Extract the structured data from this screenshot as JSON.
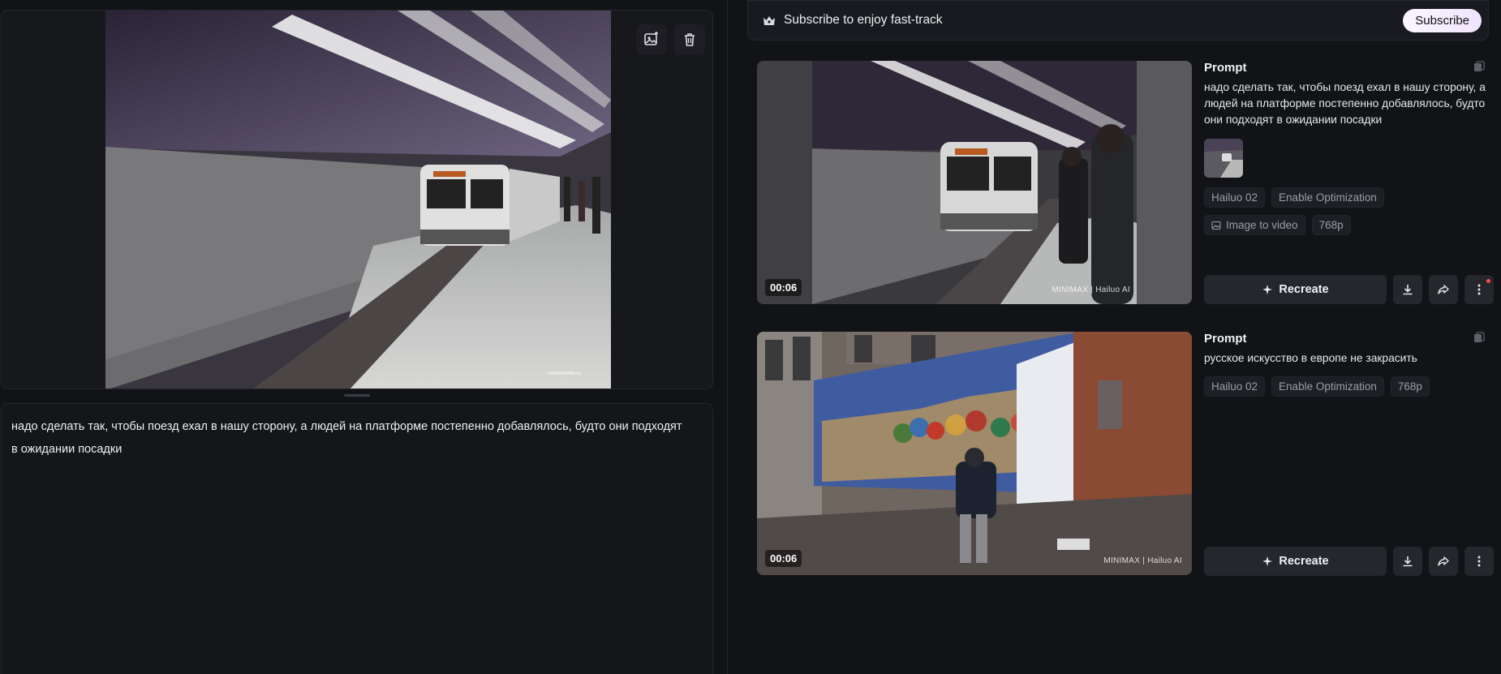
{
  "source_image": {
    "prompt_text": "надо сделать так, чтобы поезд ехал в нашу сторону, а людей на платформе постепенно добавлялось, будто они подходят в ожидании посадки",
    "watermark": "intermonitor.ru"
  },
  "subscribe_bar": {
    "text": "Subscribe to enjoy fast-track",
    "button_label": "Subscribe"
  },
  "cards": [
    {
      "duration": "00:06",
      "prompt_label": "Prompt",
      "prompt": "надо сделать так, чтобы поезд ехал в нашу сторону, а людей на платформе постепенно добавлялось, будто они подходят в ожидании посадки",
      "tags": [
        "Hailuo 02",
        "Enable Optimization"
      ],
      "tags2": [
        "Image to video",
        "768p"
      ],
      "recreate_label": "Recreate",
      "watermark": "MINIMAX | Hailuo AI"
    },
    {
      "duration": "00:06",
      "prompt_label": "Prompt",
      "prompt": "русское искусство в европе не закрасить",
      "tags": [
        "Hailuo 02",
        "Enable Optimization",
        "768p"
      ],
      "recreate_label": "Recreate",
      "watermark": "MINIMAX | Hailuo AI"
    }
  ]
}
